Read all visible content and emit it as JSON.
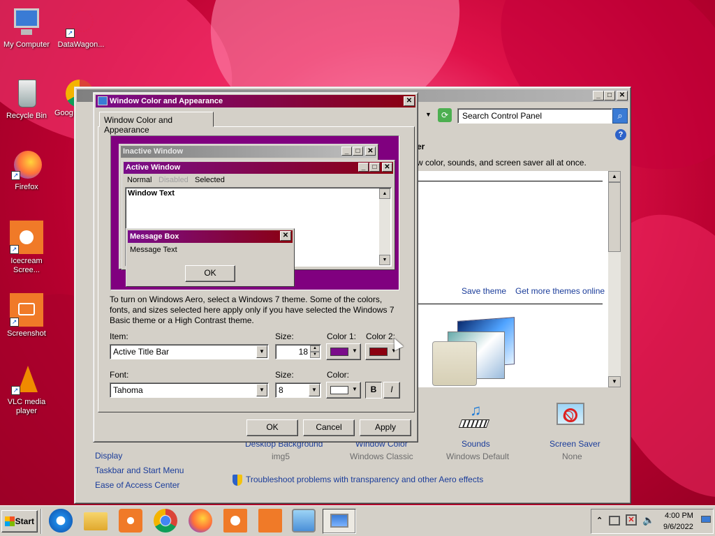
{
  "desktop": {
    "icons": [
      {
        "label": "My Computer",
        "name": "my-computer"
      },
      {
        "label": "DataWagon...",
        "name": "datawagon"
      },
      {
        "label": "Recycle Bin",
        "name": "recycle-bin"
      },
      {
        "label": "Goog",
        "name": "google-chrome"
      },
      {
        "label": "Firefox",
        "name": "firefox"
      },
      {
        "label": "Icecream Scree...",
        "name": "icecream"
      },
      {
        "label": "Screenshot",
        "name": "screenshot"
      },
      {
        "label": "VLC media player",
        "name": "vlc"
      }
    ]
  },
  "control_panel": {
    "search_placeholder": "Search Control Panel",
    "heading_fragment": "er",
    "subtitle_fragment": "w color, sounds, and screen saver all at once.",
    "save_theme": "Save theme",
    "more_themes": "Get more themes online",
    "bottom_items": [
      {
        "title": "Desktop Background",
        "value": "img5"
      },
      {
        "title": "Window Color",
        "value": "Windows Classic"
      },
      {
        "title": "Sounds",
        "value": "Windows Default"
      },
      {
        "title": "Screen Saver",
        "value": "None"
      }
    ],
    "see_also": [
      "Display",
      "Taskbar and Start Menu",
      "Ease of Access Center"
    ],
    "troubleshoot": "Troubleshoot problems with transparency and other Aero effects"
  },
  "dialog": {
    "title": "Window Color and Appearance",
    "tab": "Window Color and Appearance",
    "preview": {
      "inactive": "Inactive Window",
      "active": "Active Window",
      "menu_normal": "Normal",
      "menu_disabled": "Disabled",
      "menu_selected": "Selected",
      "window_text": "Window Text",
      "msgbox_title": "Message Box",
      "msgbox_text": "Message Text",
      "ok": "OK"
    },
    "info": "To turn on Windows Aero, select a Windows 7 theme.  Some of the colors, fonts, and sizes selected here apply only if you have selected the Windows 7 Basic theme or a High Contrast theme.",
    "item_label": "Item:",
    "item_value": "Active Title Bar",
    "size_label": "Size:",
    "size_value": "18",
    "color1_label": "Color 1:",
    "color2_label": "Color 2:",
    "color1": "#7a0d8a",
    "color2": "#8b0010",
    "font_label": "Font:",
    "font_value": "Tahoma",
    "font_size_label": "Size:",
    "font_size_value": "8",
    "font_color_label": "Color:",
    "font_color": "#ffffff",
    "bold": "B",
    "italic": "I",
    "ok": "OK",
    "cancel": "Cancel",
    "apply": "Apply"
  },
  "taskbar": {
    "start": "Start",
    "time": "4:00 PM",
    "date": "9/6/2022"
  },
  "colors": {
    "active_title": "#7a0d8a",
    "active_title_end": "#8b0010",
    "inactive_title": "#808080",
    "preview_bg": "#80007f"
  }
}
